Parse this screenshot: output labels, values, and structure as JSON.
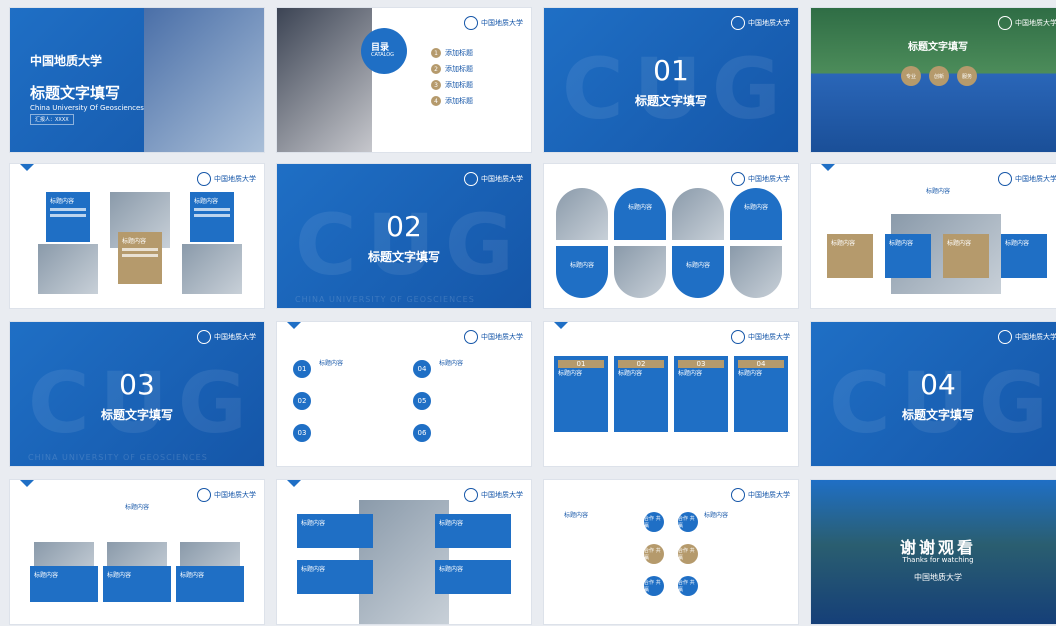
{
  "logo_text": "中国地质大学",
  "cover": {
    "title": "标题文字填写",
    "subtitle": "China University Of Geosciences",
    "logo_sub": "CHINA UNIVERSITY OF GEOSCIENCES",
    "tag": "汇报人：XXXX"
  },
  "toc": {
    "title": "目录",
    "title_en": "CATALOG",
    "items": [
      {
        "num": "1",
        "label": "添加标题"
      },
      {
        "num": "2",
        "label": "添加标题"
      },
      {
        "num": "3",
        "label": "添加标题"
      },
      {
        "num": "4",
        "label": "添加标题"
      }
    ]
  },
  "sections": [
    {
      "num": "01",
      "title": "标题文字填写"
    },
    {
      "num": "02",
      "title": "标题文字填写"
    },
    {
      "num": "03",
      "title": "标题文字填写"
    },
    {
      "num": "04",
      "title": "标题文字填写"
    }
  ],
  "watermark": "CUG",
  "watermark_sub": "CHINA UNIVERSITY OF GEOSCIENCES",
  "common": {
    "content_label": "标题内容",
    "content_label_alt": "添加标题",
    "circle_label": "合作\n共赢"
  },
  "campus_slide": {
    "title": "标题文字填写",
    "pills": [
      "专业",
      "创新",
      "服务"
    ]
  },
  "numbers_grid": [
    "01",
    "02",
    "03",
    "04",
    "05",
    "06"
  ],
  "cards_slide": [
    "01",
    "02",
    "03",
    "04"
  ],
  "thanks": {
    "title": "谢谢观看",
    "subtitle": "Thanks for watching"
  },
  "colors": {
    "primary": "#1f6fc5",
    "primary_dark": "#1556a8",
    "accent": "#b59a6c",
    "bg": "#e9ecf1"
  }
}
